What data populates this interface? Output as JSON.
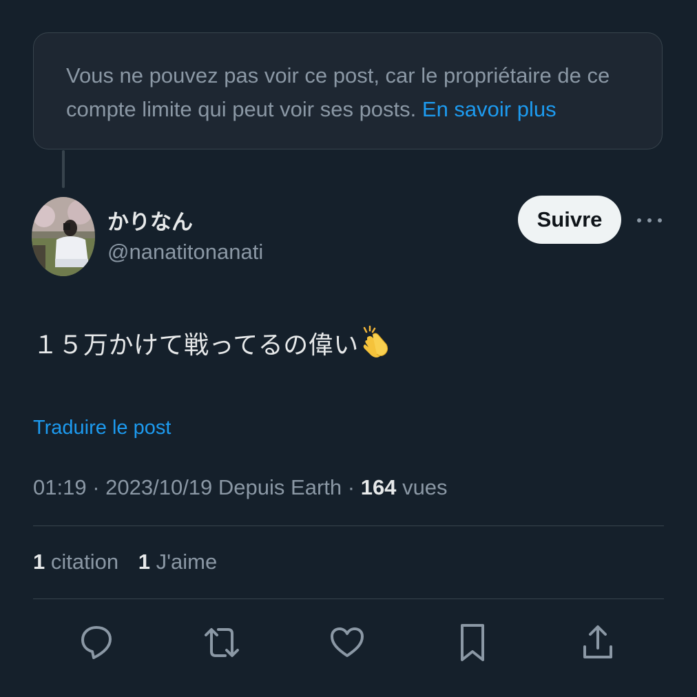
{
  "notice": {
    "text": "Vous ne pouvez pas voir ce post, car le propriétaire de ce compte limite qui peut voir ses posts.",
    "link": "En savoir plus"
  },
  "author": {
    "display_name": "かりなん",
    "handle": "@nanatitonanati"
  },
  "follow_label": "Suivre",
  "post": {
    "text": "１５万かけて戦ってるの偉い",
    "emoji": "clapping-hands-icon"
  },
  "translate_label": "Traduire le post",
  "meta": {
    "time": "01:19",
    "date": "2023/10/19",
    "location": "Depuis Earth",
    "views_count": "164",
    "views_label": "vues"
  },
  "stats": {
    "quotes_count": "1",
    "quotes_label": "citation",
    "likes_count": "1",
    "likes_label": "J'aime"
  },
  "actions": [
    "reply-icon",
    "repost-icon",
    "like-icon",
    "bookmark-icon",
    "share-icon"
  ],
  "colors": {
    "background": "#15202b",
    "accent": "#1d9bf0",
    "secondary_text": "#8b98a5",
    "divider": "#38444d"
  }
}
